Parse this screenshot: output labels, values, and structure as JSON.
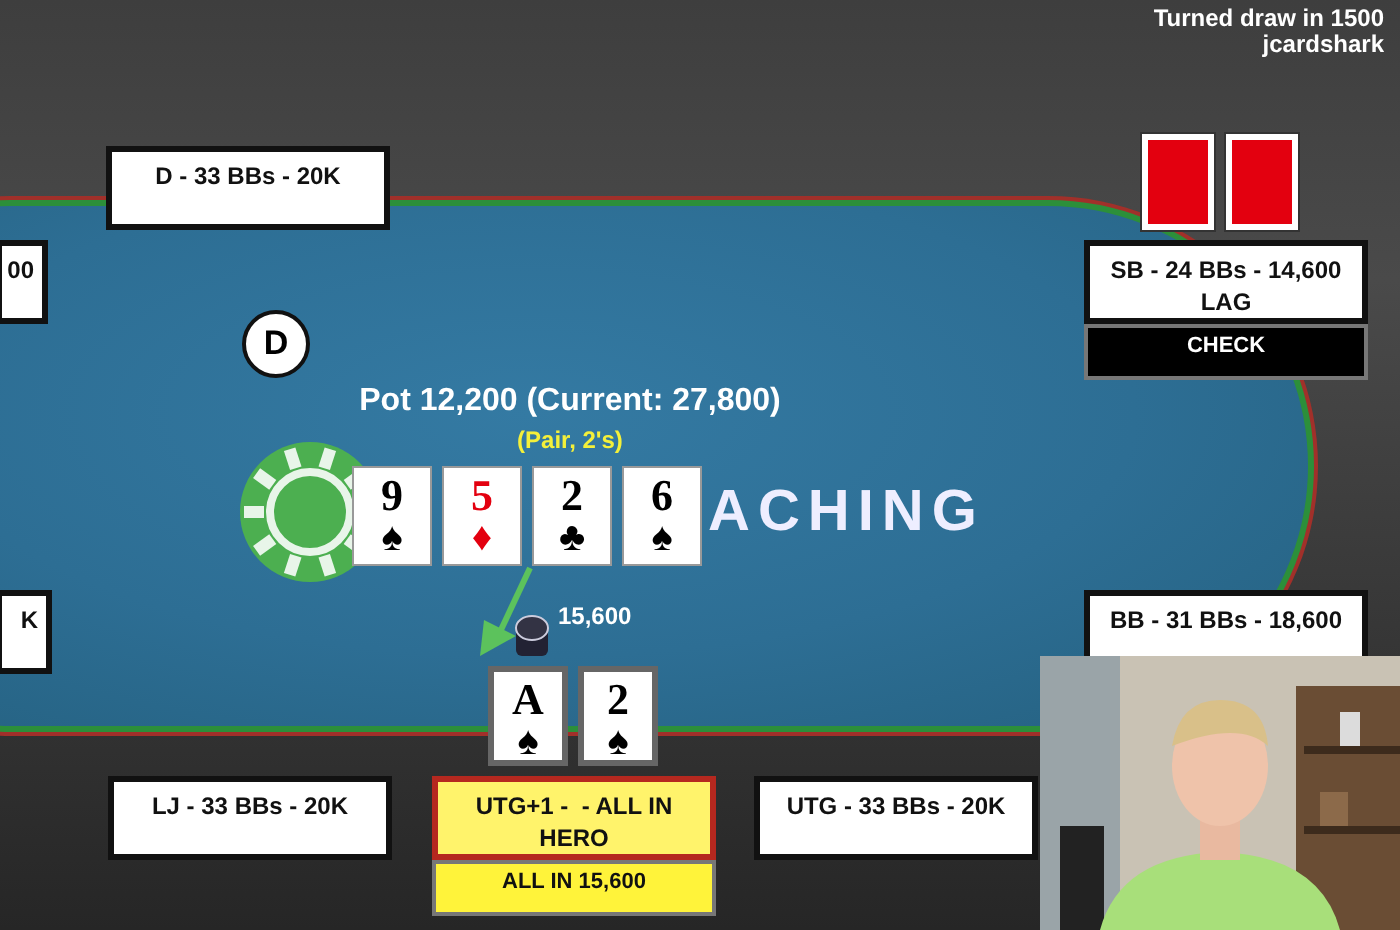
{
  "header": {
    "title": "Turned draw in 1500",
    "author": "jcardshark"
  },
  "dealer_button": "D",
  "pot": "Pot 12,200 (Current: 27,800)",
  "hand": "(Pair, 2's)",
  "logo_text": "ACHING",
  "board": [
    {
      "rank": "9",
      "suit": "♠",
      "color": "#000000"
    },
    {
      "rank": "5",
      "suit": "♦",
      "color": "#e3000f"
    },
    {
      "rank": "2",
      "suit": "♣",
      "color": "#000000"
    },
    {
      "rank": "6",
      "suit": "♠",
      "color": "#000000"
    }
  ],
  "bet": "15,600",
  "seats": [
    {
      "kind": "player",
      "label": "D - 33 BBs - 20K"
    },
    {
      "kind": "edge",
      "label": "00"
    },
    {
      "kind": "player",
      "label": "SB - 24 BBs - 14,600",
      "note": "LAG",
      "action": "CHECK",
      "hole_cards": [
        {
          "face_up": false
        },
        {
          "face_up": false
        }
      ]
    },
    {
      "kind": "edge",
      "label": "K"
    },
    {
      "kind": "player",
      "label": "BB - 31 BBs - 18,600"
    },
    {
      "kind": "player",
      "label": "LJ - 33 BBs - 20K"
    },
    {
      "kind": "hero",
      "label": "UTG+1 -  - ALL IN",
      "note": "HERO",
      "action": "ALL IN 15,600",
      "hole_cards": [
        {
          "face_up": true,
          "rank": "A",
          "suit": "♠",
          "color": "#000000"
        },
        {
          "face_up": true,
          "rank": "2",
          "suit": "♠",
          "color": "#000000"
        }
      ]
    },
    {
      "kind": "player",
      "label": "UTG - 33 BBs - 20K"
    }
  ]
}
